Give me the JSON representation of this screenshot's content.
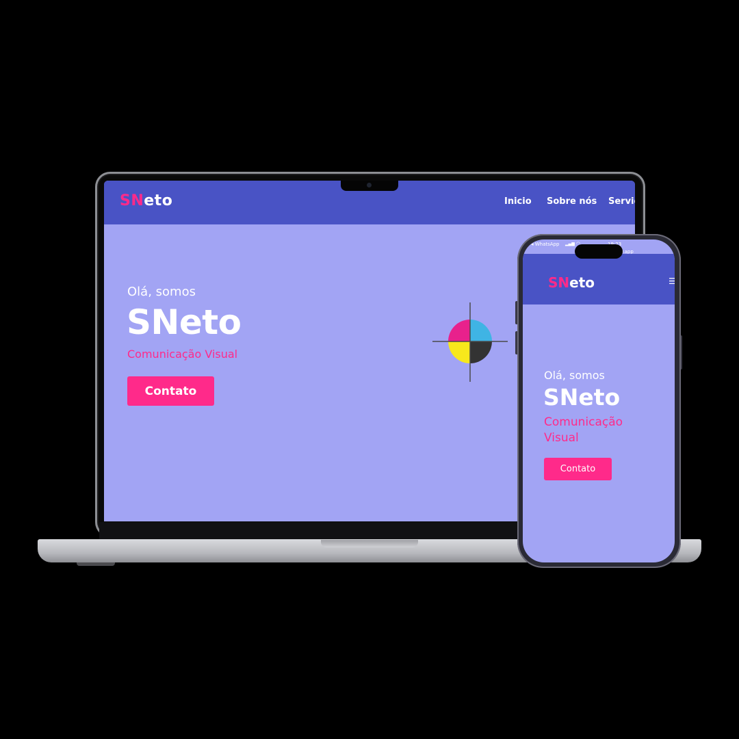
{
  "brand": {
    "initials": "SN",
    "rest": "eto"
  },
  "laptop": {
    "nav": {
      "items": [
        "Inicio",
        "Sobre nós",
        "Serviç"
      ]
    },
    "hero": {
      "greeting": "Olá, somos",
      "title": "SNeto",
      "subtitle": "Comunicação Visual",
      "cta": "Contato"
    }
  },
  "phone": {
    "status": {
      "carrier": "◂ WhatsApp",
      "time": "19:23",
      "url": "lify.app"
    },
    "hero": {
      "greeting": "Olá, somos",
      "title": "SNeto",
      "subtitle": "Comunicação Visual",
      "cta": "Contato"
    },
    "menu_icon": "hamburger-icon"
  },
  "colors": {
    "nav": "#4953c5",
    "hero_bg": "#a2a4f4",
    "accent": "#ff2a8a",
    "cyan": "#3fb4e4",
    "magenta": "#e8218c",
    "yellow": "#f7e81c",
    "key": "#333333"
  }
}
